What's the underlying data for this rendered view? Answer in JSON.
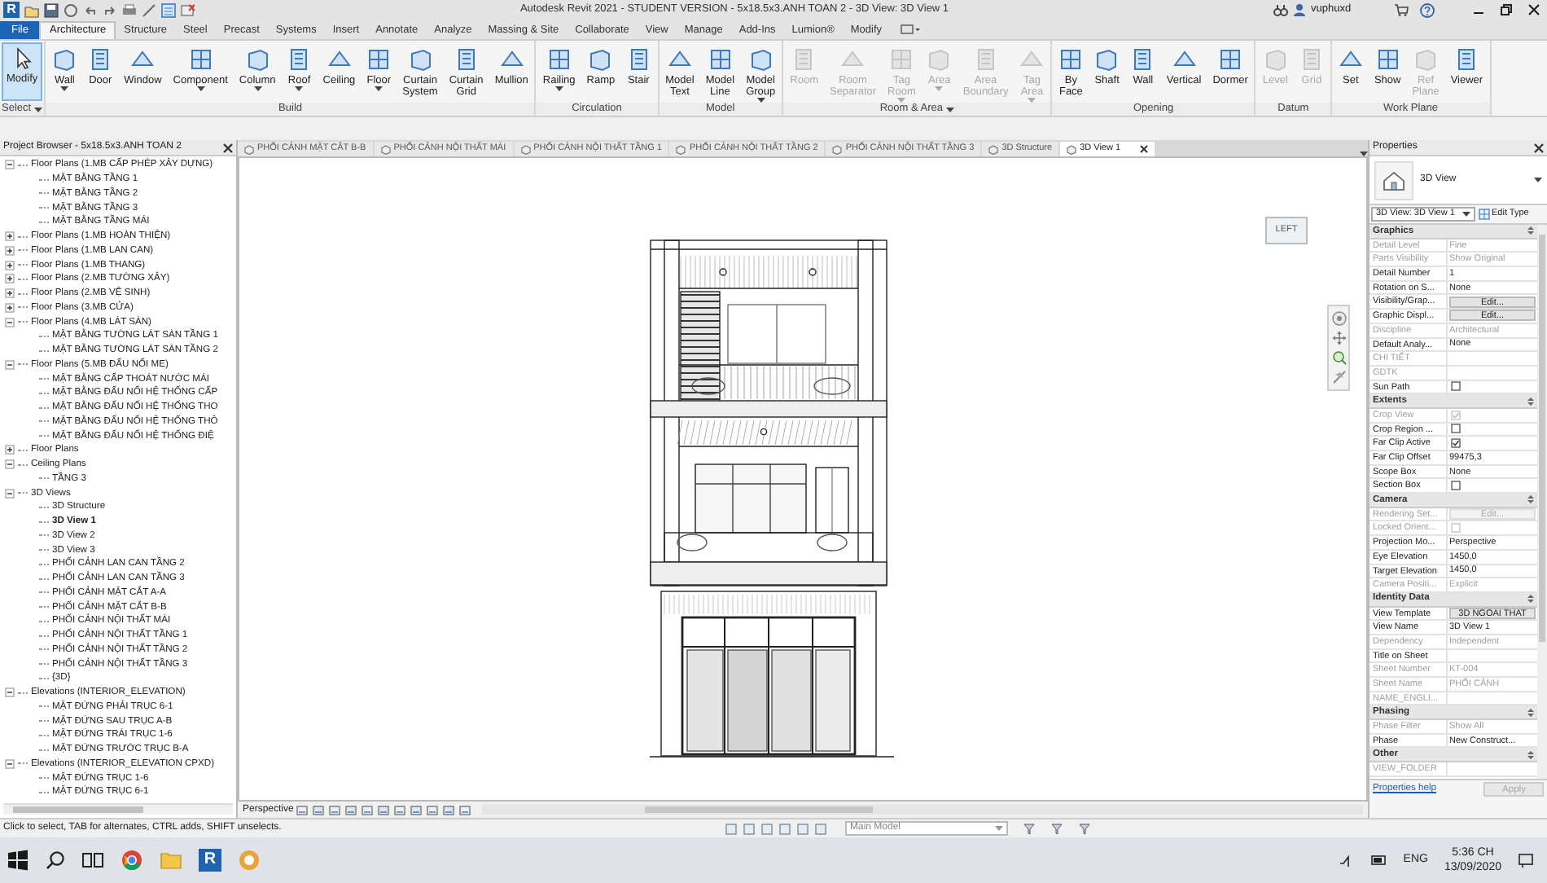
{
  "title_bar": {
    "logo": "R",
    "title": "Autodesk Revit 2021 - STUDENT VERSION - 5x18.5x3.ANH TOAN 2 - 3D View: 3D View 1",
    "user": "vuphuxd"
  },
  "ribbon_tabs": [
    {
      "label": "File",
      "kind": "file",
      "selected": false
    },
    {
      "label": "Architecture",
      "kind": "tab",
      "selected": true
    },
    {
      "label": "Structure",
      "kind": "tab",
      "selected": false
    },
    {
      "label": "Steel",
      "kind": "tab",
      "selected": false
    },
    {
      "label": "Precast",
      "kind": "tab",
      "selected": false
    },
    {
      "label": "Systems",
      "kind": "tab",
      "selected": false
    },
    {
      "label": "Insert",
      "kind": "tab",
      "selected": false
    },
    {
      "label": "Annotate",
      "kind": "tab",
      "selected": false
    },
    {
      "label": "Analyze",
      "kind": "tab",
      "selected": false
    },
    {
      "label": "Massing & Site",
      "kind": "tab",
      "selected": false
    },
    {
      "label": "Collaborate",
      "kind": "tab",
      "selected": false
    },
    {
      "label": "View",
      "kind": "tab",
      "selected": false
    },
    {
      "label": "Manage",
      "kind": "tab",
      "selected": false
    },
    {
      "label": "Add-Ins",
      "kind": "tab",
      "selected": false
    },
    {
      "label": "Lumion®",
      "kind": "tab",
      "selected": false
    },
    {
      "label": "Modify",
      "kind": "tab",
      "selected": false
    }
  ],
  "ribbon_panels": [
    {
      "label": "Select",
      "dropdown": true,
      "buttons": [
        {
          "label": "Modify",
          "selected": true,
          "disabled": false,
          "dropdown": false
        }
      ]
    },
    {
      "label": "Build",
      "dropdown": false,
      "buttons": [
        {
          "label": "Wall",
          "selected": false,
          "disabled": false,
          "dropdown": true
        },
        {
          "label": "Door",
          "selected": false,
          "disabled": false,
          "dropdown": false
        },
        {
          "label": "Window",
          "selected": false,
          "disabled": false,
          "dropdown": false
        },
        {
          "label": "Component",
          "selected": false,
          "disabled": false,
          "dropdown": true
        },
        {
          "label": "Column",
          "selected": false,
          "disabled": false,
          "dropdown": true
        },
        {
          "label": "Roof",
          "selected": false,
          "disabled": false,
          "dropdown": true
        },
        {
          "label": "Ceiling",
          "selected": false,
          "disabled": false,
          "dropdown": false
        },
        {
          "label": "Floor",
          "selected": false,
          "disabled": false,
          "dropdown": true
        },
        {
          "label": "Curtain\nSystem",
          "selected": false,
          "disabled": false,
          "dropdown": false
        },
        {
          "label": "Curtain\nGrid",
          "selected": false,
          "disabled": false,
          "dropdown": false
        },
        {
          "label": "Mullion",
          "selected": false,
          "disabled": false,
          "dropdown": false
        }
      ]
    },
    {
      "label": "Circulation",
      "dropdown": false,
      "buttons": [
        {
          "label": "Railing",
          "selected": false,
          "disabled": false,
          "dropdown": true
        },
        {
          "label": "Ramp",
          "selected": false,
          "disabled": false,
          "dropdown": false
        },
        {
          "label": "Stair",
          "selected": false,
          "disabled": false,
          "dropdown": false
        }
      ]
    },
    {
      "label": "Model",
      "dropdown": false,
      "buttons": [
        {
          "label": "Model\nText",
          "selected": false,
          "disabled": false,
          "dropdown": false
        },
        {
          "label": "Model\nLine",
          "selected": false,
          "disabled": false,
          "dropdown": false
        },
        {
          "label": "Model\nGroup",
          "selected": false,
          "disabled": false,
          "dropdown": true
        }
      ]
    },
    {
      "label": "Room & Area",
      "dropdown": true,
      "buttons": [
        {
          "label": "Room",
          "selected": false,
          "disabled": true,
          "dropdown": false
        },
        {
          "label": "Room\nSeparator",
          "selected": false,
          "disabled": true,
          "dropdown": false
        },
        {
          "label": "Tag\nRoom",
          "selected": false,
          "disabled": true,
          "dropdown": true
        },
        {
          "label": "Area",
          "selected": false,
          "disabled": true,
          "dropdown": true
        },
        {
          "label": "Area\nBoundary",
          "selected": false,
          "disabled": true,
          "dropdown": false
        },
        {
          "label": "Tag\nArea",
          "selected": false,
          "disabled": true,
          "dropdown": true
        }
      ]
    },
    {
      "label": "Opening",
      "dropdown": false,
      "buttons": [
        {
          "label": "By\nFace",
          "selected": false,
          "disabled": false,
          "dropdown": false
        },
        {
          "label": "Shaft",
          "selected": false,
          "disabled": false,
          "dropdown": false
        },
        {
          "label": "Wall",
          "selected": false,
          "disabled": false,
          "dropdown": false
        },
        {
          "label": "Vertical",
          "selected": false,
          "disabled": false,
          "dropdown": false
        },
        {
          "label": "Dormer",
          "selected": false,
          "disabled": false,
          "dropdown": false
        }
      ]
    },
    {
      "label": "Datum",
      "dropdown": false,
      "buttons": [
        {
          "label": "Level",
          "selected": false,
          "disabled": true,
          "dropdown": false
        },
        {
          "label": "Grid",
          "selected": false,
          "disabled": true,
          "dropdown": false
        }
      ]
    },
    {
      "label": "Work Plane",
      "dropdown": false,
      "buttons": [
        {
          "label": "Set",
          "selected": false,
          "disabled": false,
          "dropdown": false
        },
        {
          "label": "Show",
          "selected": false,
          "disabled": false,
          "dropdown": false
        },
        {
          "label": "Ref\nPlane",
          "selected": false,
          "disabled": true,
          "dropdown": false
        },
        {
          "label": "Viewer",
          "selected": false,
          "disabled": false,
          "dropdown": false
        }
      ]
    }
  ],
  "project_browser": {
    "title": "Project Browser - 5x18.5x3.ANH TOAN 2",
    "tree": [
      {
        "label": "Floor Plans (1.MB CẤP PHÉP XÂY DỰNG)",
        "expanded": true,
        "selected": false,
        "children": [
          {
            "label": "MẶT BẰNG TẦNG 1",
            "selected": false
          },
          {
            "label": "MẶT BẰNG TẦNG 2",
            "selected": false
          },
          {
            "label": "MẶT BẰNG TẦNG 3",
            "selected": false
          },
          {
            "label": "MẶT BẰNG TẦNG MÁI",
            "selected": false
          }
        ]
      },
      {
        "label": "Floor Plans (1.MB HOÀN THIỆN)",
        "expanded": false,
        "selected": false
      },
      {
        "label": "Floor Plans (1.MB LAN CAN)",
        "expanded": false,
        "selected": false
      },
      {
        "label": "Floor Plans (1.MB THANG)",
        "expanded": false,
        "selected": false
      },
      {
        "label": "Floor Plans (2.MB TƯỜNG XÂY)",
        "expanded": false,
        "selected": false
      },
      {
        "label": "Floor Plans (2.MB VỆ SINH)",
        "expanded": false,
        "selected": false
      },
      {
        "label": "Floor Plans (3.MB CỬA)",
        "expanded": false,
        "selected": false
      },
      {
        "label": "Floor Plans (4.MB LÁT SÀN)",
        "expanded": true,
        "selected": false,
        "children": [
          {
            "label": "MẶT BẰNG TƯỜNG LÁT SÀN TẦNG 1",
            "selected": false
          },
          {
            "label": "MẶT BẰNG TƯỜNG LÁT SÀN TẦNG 2",
            "selected": false
          }
        ]
      },
      {
        "label": "Floor Plans (5.MB ĐẤU NỐI ME)",
        "expanded": true,
        "selected": false,
        "children": [
          {
            "label": "MẶT BẰNG CẤP THOÁT NƯỚC MÁI",
            "selected": false
          },
          {
            "label": "MẶT BẰNG ĐẤU NỐI HỆ THỐNG CẤP",
            "selected": false
          },
          {
            "label": "MẶT BẰNG ĐẤU NỐI HỆ THỐNG THO",
            "selected": false
          },
          {
            "label": "MẶT BẰNG ĐẤU NỐI HỆ THỐNG THÔ",
            "selected": false
          },
          {
            "label": "MẶT BẰNG ĐẤU NỐI HỆ THỐNG ĐIỆ",
            "selected": false
          }
        ]
      },
      {
        "label": "Floor Plans",
        "expanded": false,
        "selected": false
      },
      {
        "label": "Ceiling Plans",
        "expanded": true,
        "selected": false,
        "children": [
          {
            "label": "TẦNG 3",
            "selected": false
          }
        ]
      },
      {
        "label": "3D Views",
        "expanded": true,
        "selected": false,
        "children": [
          {
            "label": "3D Structure",
            "selected": false
          },
          {
            "label": "3D View 1",
            "selected": true
          },
          {
            "label": "3D View 2",
            "selected": false
          },
          {
            "label": "3D View 3",
            "selected": false
          },
          {
            "label": "PHỐI CẢNH LAN CAN TẦNG 2",
            "selected": false
          },
          {
            "label": "PHỐI CẢNH LAN CAN TẦNG 3",
            "selected": false
          },
          {
            "label": "PHỐI CẢNH MẶT CẮT A-A",
            "selected": false
          },
          {
            "label": "PHỐI CẢNH MẶT CẮT B-B",
            "selected": false
          },
          {
            "label": "PHỐI CẢNH NỘI THẤT MÁI",
            "selected": false
          },
          {
            "label": "PHỐI CẢNH NỘI THẤT TẦNG 1",
            "selected": false
          },
          {
            "label": "PHỐI CẢNH NỘI THẤT TẦNG 2",
            "selected": false
          },
          {
            "label": "PHỐI CẢNH NỘI THẤT TẦNG 3",
            "selected": false
          },
          {
            "label": "{3D}",
            "selected": false
          }
        ]
      },
      {
        "label": "Elevations (INTERIOR_ELEVATION)",
        "expanded": true,
        "selected": false,
        "children": [
          {
            "label": "MẶT ĐỨNG PHẢI TRỤC 6-1",
            "selected": false
          },
          {
            "label": "MẶT ĐỨNG SAU TRỤC A-B",
            "selected": false
          },
          {
            "label": "MẶT ĐỨNG TRÁI TRỤC 1-6",
            "selected": false
          },
          {
            "label": "MẶT ĐỨNG TRƯỚC TRỤC B-A",
            "selected": false
          }
        ]
      },
      {
        "label": "Elevations (INTERIOR_ELEVATION CPXD)",
        "expanded": true,
        "selected": false,
        "children": [
          {
            "label": "MẶT ĐỨNG TRỤC 1-6",
            "selected": false
          },
          {
            "label": "MẶT ĐỨNG TRỤC 6-1",
            "selected": false
          }
        ]
      }
    ]
  },
  "view_tabs": [
    {
      "label": "PHỐI CẢNH MẶT CẮT B-B",
      "selected": false
    },
    {
      "label": "PHỐI CẢNH NỘI THẤT MÁI",
      "selected": false
    },
    {
      "label": "PHỐI CẢNH NỘI THẤT TẦNG 1",
      "selected": false
    },
    {
      "label": "PHỐI CẢNH NỘI THẤT TẦNG 2",
      "selected": false
    },
    {
      "label": "PHỐI CẢNH NỘI THẤT TẦNG 3",
      "selected": false
    },
    {
      "label": "3D Structure",
      "selected": false
    },
    {
      "label": "3D View 1",
      "selected": true
    }
  ],
  "view_cube": {
    "face": "LEFT"
  },
  "view_control_bar": {
    "scale": "Perspective"
  },
  "properties": {
    "title": "Properties",
    "type": "3D View",
    "instance": "3D View: 3D View 1",
    "edit_type": "Edit Type",
    "groups": [
      {
        "label": "Graphics",
        "rows": [
          {
            "label": "Detail Level",
            "value": "Fine",
            "kind": "text",
            "disabled": true
          },
          {
            "label": "Parts Visibility",
            "value": "Show Original",
            "kind": "text",
            "disabled": true
          },
          {
            "label": "Detail Number",
            "value": "1",
            "kind": "text",
            "disabled": false
          },
          {
            "label": "Rotation on S...",
            "value": "None",
            "kind": "text",
            "disabled": false
          },
          {
            "label": "Visibility/Grap...",
            "value": "Edit...",
            "kind": "button",
            "disabled": false
          },
          {
            "label": "Graphic Displ...",
            "value": "Edit...",
            "kind": "button",
            "disabled": false
          },
          {
            "label": "Discipline",
            "value": "Architectural",
            "kind": "text",
            "disabled": true
          },
          {
            "label": "Default Analy...",
            "value": "None",
            "kind": "text",
            "disabled": false
          },
          {
            "label": "CHI TIẾT",
            "kind": "text",
            "disabled": true
          },
          {
            "label": "GDTK",
            "kind": "text",
            "disabled": true
          },
          {
            "label": "Sun Path",
            "kind": "checkbox",
            "checked": false,
            "disabled": false
          }
        ]
      },
      {
        "label": "Extents",
        "rows": [
          {
            "label": "Crop View",
            "kind": "checkbox",
            "checked": true,
            "disabled": true
          },
          {
            "label": "Crop Region ...",
            "kind": "checkbox",
            "checked": false,
            "disabled": false
          },
          {
            "label": "Far Clip Active",
            "kind": "checkbox",
            "checked": true,
            "disabled": false
          },
          {
            "label": "Far Clip Offset",
            "value": "99475,3",
            "kind": "text",
            "disabled": false
          },
          {
            "label": "Scope Box",
            "value": "None",
            "kind": "text",
            "disabled": false
          },
          {
            "label": "Section Box",
            "kind": "checkbox",
            "checked": false,
            "disabled": false
          }
        ]
      },
      {
        "label": "Camera",
        "rows": [
          {
            "label": "Rendering Set...",
            "value": "Edit...",
            "kind": "button",
            "disabled": true
          },
          {
            "label": "Locked Orient...",
            "kind": "checkbox",
            "checked": false,
            "disabled": true
          },
          {
            "label": "Projection Mo...",
            "value": "Perspective",
            "kind": "text",
            "disabled": false
          },
          {
            "label": "Eye Elevation",
            "value": "1450,0",
            "kind": "text",
            "disabled": false
          },
          {
            "label": "Target Elevation",
            "value": "1450,0",
            "kind": "text",
            "disabled": false
          },
          {
            "label": "Camera Positi...",
            "value": "Explicit",
            "kind": "text",
            "disabled": true
          }
        ]
      },
      {
        "label": "Identity Data",
        "rows": [
          {
            "label": "View Template",
            "value": "3D NGOAI THAT",
            "kind": "button",
            "disabled": false
          },
          {
            "label": "View Name",
            "value": "3D View 1",
            "kind": "text",
            "disabled": false
          },
          {
            "label": "Dependency",
            "value": "Independent",
            "kind": "text",
            "disabled": true
          },
          {
            "label": "Title on Sheet",
            "kind": "text",
            "disabled": false
          },
          {
            "label": "Sheet Number",
            "value": "KT-004",
            "kind": "text",
            "disabled": true
          },
          {
            "label": "Sheet Name",
            "value": "PHỐI CẢNH",
            "kind": "text",
            "disabled": true
          },
          {
            "label": "NAME_ENGLI...",
            "kind": "text",
            "disabled": true
          }
        ]
      },
      {
        "label": "Phasing",
        "rows": [
          {
            "label": "Phase Filter",
            "value": "Show All",
            "kind": "text",
            "disabled": true
          },
          {
            "label": "Phase",
            "value": "New Construct...",
            "kind": "text",
            "disabled": false
          }
        ]
      },
      {
        "label": "Other",
        "rows": [
          {
            "label": "VIEW_FOLDER",
            "kind": "text",
            "disabled": true
          }
        ]
      }
    ],
    "help_link": "Properties help",
    "apply": "Apply"
  },
  "status_bar": {
    "message": "Click to select, TAB for alternates, CTRL adds, SHIFT unselects.",
    "model": "Main Model"
  },
  "taskbar": {
    "app_logo": "R",
    "language": "ENG",
    "time": "5:36 CH",
    "date": "13/09/2020"
  }
}
